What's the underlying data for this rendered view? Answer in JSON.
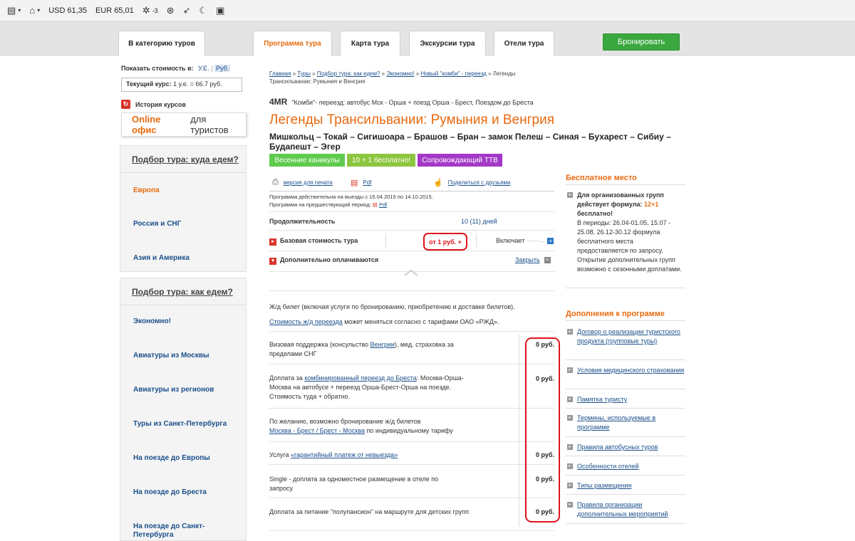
{
  "toolbar": {
    "usd_label": "USD",
    "usd_value": "61,35",
    "eur_label": "EUR",
    "eur_value": "65,01",
    "weather_value": "-3",
    "icons": [
      "notes-icon",
      "inbox-icon",
      "weather-icon",
      "sync-icon",
      "send-icon",
      "moon-icon",
      "wallet-icon"
    ]
  },
  "tabs": {
    "back": "В категорию туров",
    "program": "Программа тура",
    "map": "Карта тура",
    "excursions": "Экскурсии тура",
    "hotels": "Отели тура",
    "book": "Бронировать"
  },
  "sidebar": {
    "show_price_label": "Показать стоимость в:",
    "unit_ue": "У.Е.",
    "unit_sep": "|",
    "unit_rub": "Руб.",
    "rate_label": "Текущий курс:",
    "rate_value": "1 у.е. = 66.7 руб.",
    "history": "История курсов",
    "online_office_a": "Online офис",
    "online_office_b": "для туристов",
    "where_head": "Подбор тура: куда едем?",
    "where_items": [
      "Европа",
      "Россия и СНГ",
      "Азия и Америка"
    ],
    "how_head": "Подбор тура: как едем?",
    "how_items": [
      "Экономно!",
      "Авиатуры из Москвы",
      "Авиатуры из регионов",
      "Туры из Санкт-Петербурга",
      "На поезде до Европы",
      "На поезде до Бреста",
      "На поезде до Санкт-Петербурга"
    ]
  },
  "breadcrumb": {
    "items": [
      "Главная",
      "Туры",
      "Подбор тура: как едем?",
      "Экономно!",
      "Новый \"комби\" - переезд"
    ],
    "sep": "»",
    "current": "Легенды Трансильвании: Румыния и Венгрия"
  },
  "tour": {
    "code": "4MR",
    "transport": "\"Комби\"- переезд: автобус Мск - Орша + поезд Орша - Брест, Поездом до Бреста",
    "title": "Легенды Трансильвании: Румыния и Венгрия",
    "route": "Мишкольц – Токай – Сигишоара – Брашов – Бран – замок Пелеш – Синая – Бухарест – Сибиу – Будапешт – Эгер",
    "badges": [
      {
        "label": "Весенние каникулы",
        "color": "#5fcb4e"
      },
      {
        "label": "10 + 1 бесплатно!",
        "color": "#8cc63f"
      },
      {
        "label": "Сопровождающий ТТВ",
        "color": "#a439c7"
      }
    ]
  },
  "actions": {
    "print": "версия для печати",
    "pdf": "Pdf",
    "share": "Поделиться с друзьями",
    "valid_text": "Программа действительна на выезды с 15.04.2015 по 14.10.2015.",
    "prev_text": "Программа на предшествующий период:",
    "prev_pdf": "Pdf"
  },
  "info": {
    "duration_label": "Продолжительность",
    "duration_value": "10 (11) дней",
    "base_label": "Базовая стоимость тура",
    "base_value": "от 1 руб. +",
    "includes": "Включает",
    "extra_label": "Дополнительно оплачиваются",
    "close": "Закрыть"
  },
  "services": {
    "train_note": "Ж/д билет (включая услуги по бронированию, приобретению и доставке билетов).",
    "train_cost_link": "Стоимость ж/д переезда",
    "train_cost_rest": "может меняться согласно с тарифами ОАО «РЖД».",
    "visa_a": "Визовая поддержка (консульство",
    "visa_link": "Венгрии",
    "visa_b": "), мед. страховка за пределами СНГ",
    "visa_price": "0 руб.",
    "combo_a": "Доплата за",
    "combo_link": "комбинированный переезд до Бреста",
    "combo_b": ": Москва-Орша-Москва на автобусе + переезд Орша-Брест-Орша на поезде. Стоимость туда + обратно.",
    "combo_price": "0 руб.",
    "rail_a": "По желанию, возможно бронирование ж/д билетов",
    "rail_link": "Москва - Брест / Брест - Москва",
    "rail_b": "по индивидуальному тарифу",
    "guarantee_a": "Услуга",
    "guarantee_link": "«гарантийный платеж от невыезда»",
    "guarantee_price": "0 руб.",
    "single_text": "Single - доплата за одноместное размещение в отеле по запросу",
    "single_price": "0 руб.",
    "meal_text": "Доплата за питание \"полупансион\" на маршруте для детских групп",
    "meal_price": "0 руб."
  },
  "right": {
    "free_head": "Бесплатное место",
    "free_bold": "Для организованных групп действует формула:",
    "free_hl": "12+1",
    "free_bold2": "бесплатно!",
    "free_text": "В периоды: 26.04-01.05, 15.07 - 25.08, 26.12-30.12 формула бесплатного места предоставляется по запросу. Открытие дополнительных групп возможно с сезонными доплатами.",
    "add_head": "Дополнения к программе",
    "add_items": [
      "Договор о реализации туристского продукта (групповые туры)",
      "Условия медицинского страхования",
      "Памятка туристу",
      "Термины, используемые в программе",
      "Правила автобусных туров",
      "Особенности отелей",
      "Типы размещения",
      "Правила организации дополнительных мероприятий"
    ]
  }
}
